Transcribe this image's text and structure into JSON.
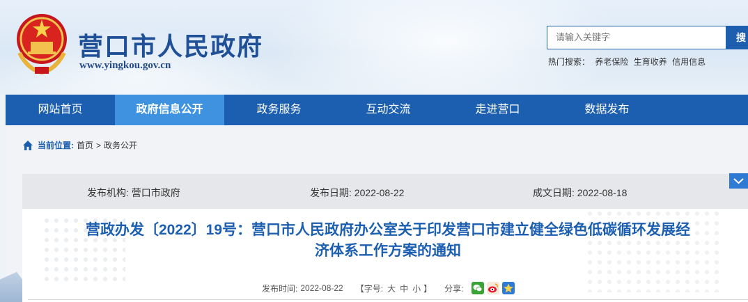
{
  "header": {
    "site_title": "营口市人民政府",
    "site_url": "www.yingkou.gov.cn",
    "search_placeholder": "请输入关键字",
    "search_button": "搜",
    "hot_label": "热门搜索：",
    "hot_items": [
      "养老保险",
      "生育收养",
      "信用信息"
    ]
  },
  "nav": {
    "items": [
      {
        "label": "网站首页"
      },
      {
        "label": "政府信息公开",
        "active": true
      },
      {
        "label": "政务服务"
      },
      {
        "label": "互动交流"
      },
      {
        "label": "走进营口"
      },
      {
        "label": "数据发布"
      }
    ]
  },
  "breadcrumb": {
    "label": "当前位置:",
    "items": [
      "首页",
      "政务公开"
    ],
    "separator": ">"
  },
  "meta": {
    "publisher_label": "发布机构:",
    "publisher": "营口市政府",
    "publish_date_label": "发布日期:",
    "publish_date": "2022-08-22",
    "written_date_label": "成文日期:",
    "written_date": "2022-08-18"
  },
  "article": {
    "title_line1": "营政办发〔2022〕19号：营口市人民政府办公室关于印发营口市建立健全绿色低碳循环发展经",
    "title_line2": "济体系工作方案的通知",
    "time_label": "发布时间:",
    "time": "2022-08-22",
    "font_label": "【字号:",
    "font_large": "大",
    "font_medium": "中",
    "font_small": "小",
    "font_close": "】",
    "share_label": "分享:"
  },
  "colors": {
    "brand_blue": "#1c5fb0",
    "nav_active": "#3f92e0"
  }
}
